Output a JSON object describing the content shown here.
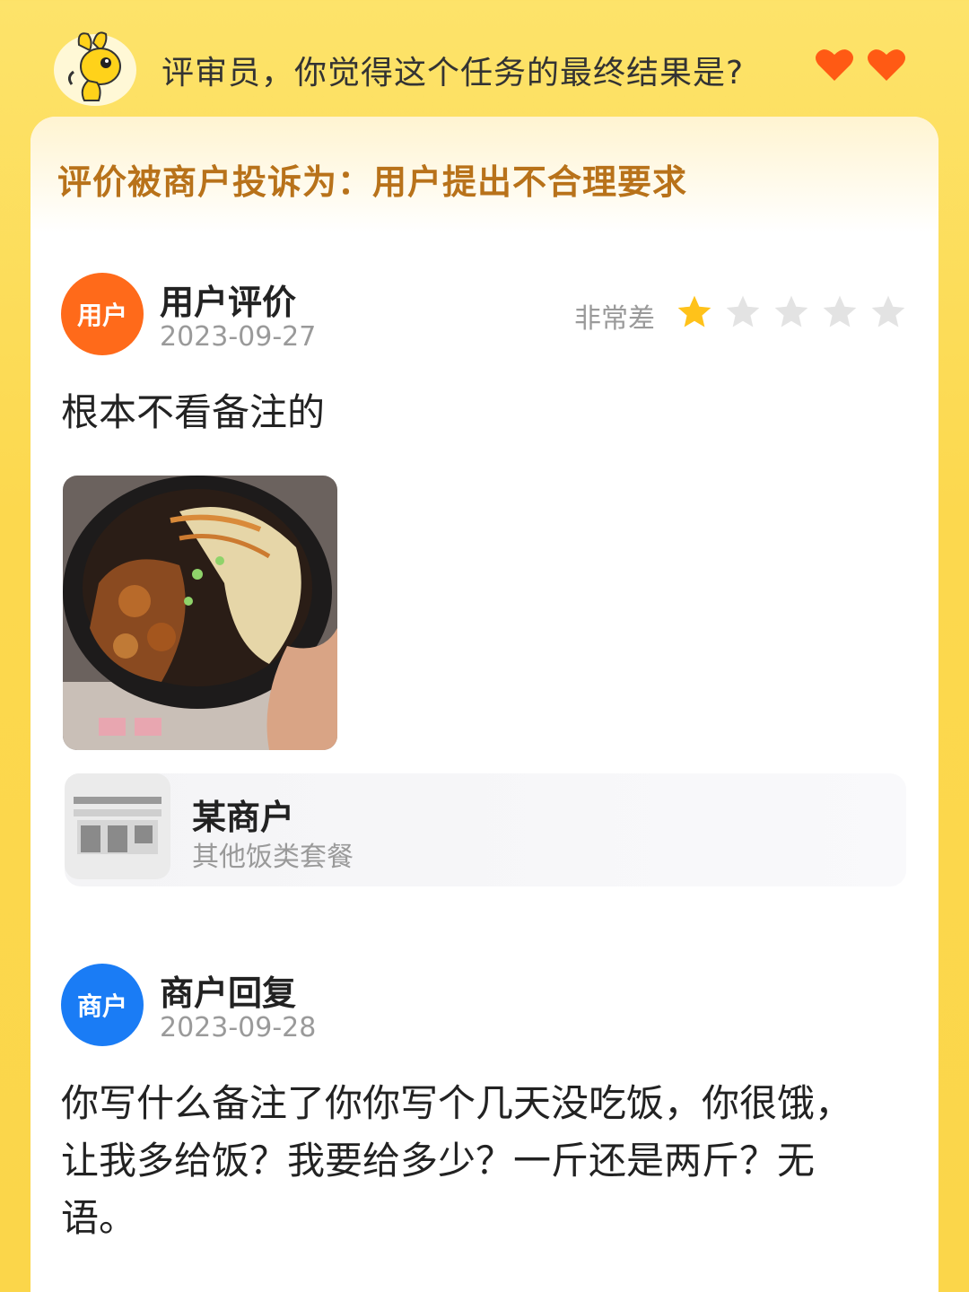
{
  "header": {
    "question": "评审员，你觉得这个任务的最终结果是?",
    "lives_icon": "heart-icon",
    "lives_count": 2,
    "heart_color": "#ff5a14"
  },
  "complaint": {
    "text": "评价被商户投诉为：用户提出不合理要求"
  },
  "user_review": {
    "avatar_label": "用户",
    "title": "用户评价",
    "date": "2023-09-27",
    "rating_label": "非常差",
    "rating": 1,
    "rating_max": 5,
    "text": "根本不看备注的",
    "photo": "food-photo"
  },
  "shop": {
    "icon": "storefront-icon",
    "name": "某商户",
    "category": "其他饭类套餐"
  },
  "merchant_reply": {
    "avatar_label": "商户",
    "title": "商户回复",
    "date": "2023-09-28",
    "text": "你写什么备注了你你写个几天没吃饭，你很饿，让我多给饭？我要给多少？一斤还是两斤？无语。"
  },
  "colors": {
    "user_avatar": "#ff6a1a",
    "merchant_avatar": "#1a7cf5",
    "complaint_text": "#b8721a",
    "star_filled": "#ffc21a",
    "star_empty": "#e3e3e3"
  }
}
